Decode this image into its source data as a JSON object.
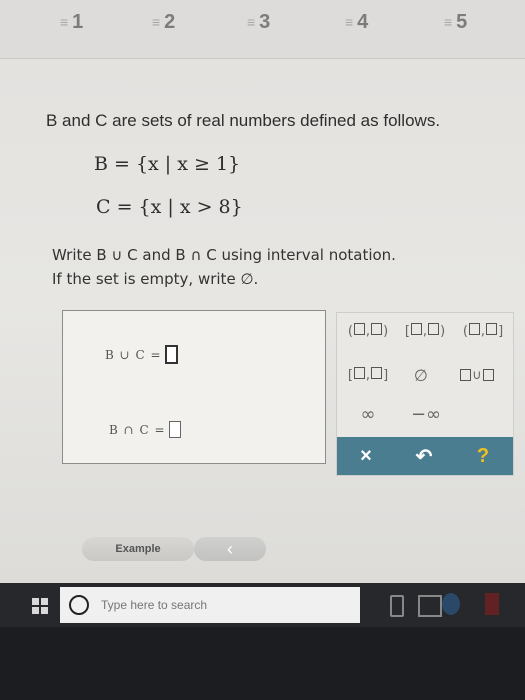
{
  "tabs": [
    {
      "label": "1"
    },
    {
      "label": "2"
    },
    {
      "label": "3"
    },
    {
      "label": "4"
    },
    {
      "label": "5"
    }
  ],
  "problem": {
    "intro": "B and C are sets of real numbers defined as follows.",
    "set_b": "B = {x | x ≥ 1}",
    "set_c": "C = {x | x > 8}",
    "instruction_1": "Write B ∪ C and B ∩ C using interval notation.",
    "instruction_2": "If the set is empty, write ∅."
  },
  "answers": {
    "union_label": "B ∪ C =",
    "intersection_label": "B ∩ C ="
  },
  "palette": {
    "empty_set": "∅",
    "infinity": "∞",
    "neg_infinity": "−∞",
    "union_op": "∪"
  },
  "controls": {
    "clear": "×",
    "undo": "↶",
    "help": "?"
  },
  "footer": {
    "example_label": "Example",
    "back_label": "‹"
  },
  "taskbar": {
    "search_placeholder": "Type here to search"
  },
  "colors": {
    "control_bar": "#4a7d90",
    "background": "#e5e4e1"
  }
}
